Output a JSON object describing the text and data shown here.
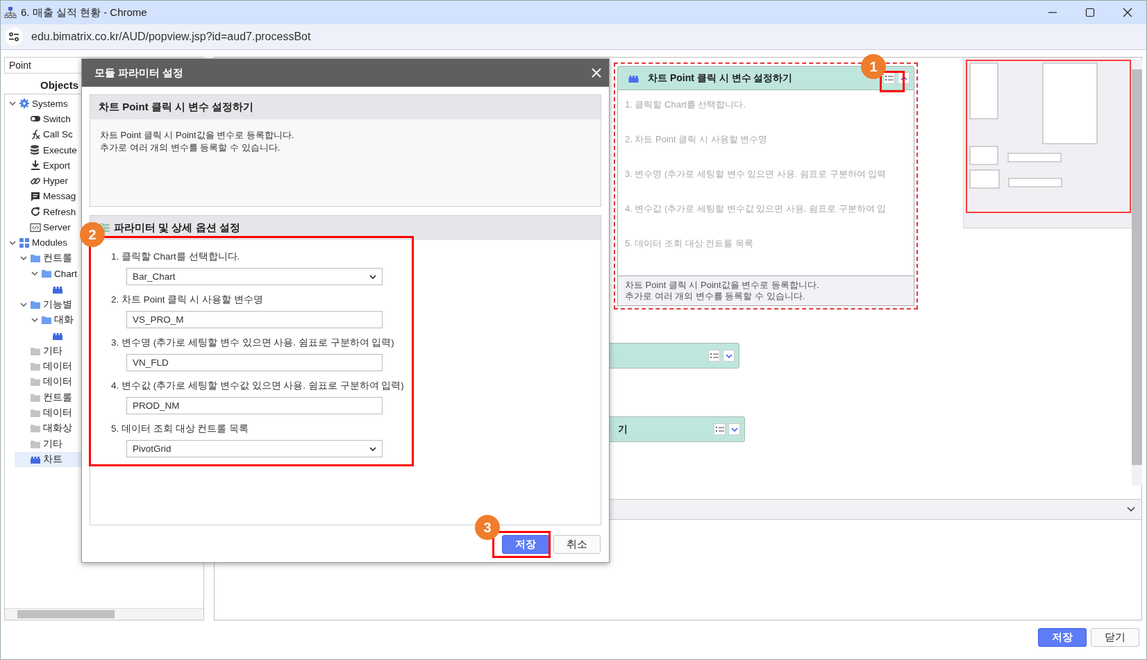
{
  "window": {
    "title": "6. 매출 실적 현황 - Chrome"
  },
  "address_bar": {
    "url": "edu.bimatrix.co.kr/AUD/popview.jsp?id=aud7.processBot"
  },
  "sidebar": {
    "search": {
      "value": "Point"
    },
    "header": "Objects",
    "tree": [
      {
        "label": "Systems",
        "kind": "gear",
        "expanded": true,
        "selected": false,
        "children": [
          {
            "label": "Switch",
            "kind": "toggle",
            "selected": false
          },
          {
            "label": "Call Sc",
            "kind": "function",
            "selected": false
          },
          {
            "label": "Execute",
            "kind": "database",
            "selected": false
          },
          {
            "label": "Export",
            "kind": "download",
            "selected": false
          },
          {
            "label": "Hyper",
            "kind": "link",
            "selected": false
          },
          {
            "label": "Messag",
            "kind": "message",
            "selected": false
          },
          {
            "label": "Refresh",
            "kind": "refresh",
            "selected": false
          },
          {
            "label": "Server",
            "kind": "code",
            "selected": false
          }
        ]
      },
      {
        "label": "Modules",
        "kind": "grid",
        "expanded": true,
        "selected": false,
        "children": [
          {
            "label": "컨트롤",
            "kind": "category",
            "expanded": true,
            "selected": false,
            "children": [
              {
                "label": "Chart",
                "kind": "category",
                "expanded": true,
                "selected": false,
                "children": [
                  {
                    "kind": "module",
                    "selected": false
                  }
                ]
              }
            ]
          },
          {
            "label": "기능별",
            "kind": "category",
            "expanded": true,
            "selected": false,
            "children": [
              {
                "label": "대화",
                "kind": "category",
                "expanded": true,
                "selected": false,
                "children": [
                  {
                    "kind": "module",
                    "selected": false
                  }
                ]
              }
            ]
          },
          {
            "label": "기타",
            "kind": "folder",
            "selected": false
          },
          {
            "label": "데이터",
            "kind": "folder",
            "selected": false
          },
          {
            "label": "데이터",
            "kind": "folder",
            "selected": false
          },
          {
            "label": "컨트롤",
            "kind": "folder",
            "selected": false
          },
          {
            "label": "데이터",
            "kind": "folder",
            "selected": false
          },
          {
            "label": "대화상",
            "kind": "folder",
            "selected": false
          },
          {
            "label": "기타",
            "kind": "folder",
            "selected": false
          },
          {
            "label": "차트",
            "kind": "module",
            "selected": true
          }
        ]
      }
    ]
  },
  "canvas": {
    "modules": [
      {
        "title": "차트 Point 클릭 시 변수 설정하기",
        "expanded": true,
        "selected": true,
        "params": [
          "1. 클릭할 Chart를 선택합니다.",
          "2. 차트 Point 클릭 시 사용할 변수명",
          "3. 변수명 (추가로 세팅할 변수 있으면 사용. 쉼표로 구분하여 입력",
          "4. 변수값 (추가로 세팅할 변수값 있으면 사용. 쉼표로 구분하여 입",
          "5. 데이터 조회 대상 컨트롤 목록"
        ],
        "description": [
          "차트 Point 클릭 시 Point값을 변수로 등록합니다.",
          "추가로  여러 개의 변수를 등록할 수 있습니다."
        ]
      },
      {
        "expanded": false,
        "selected": false
      },
      {
        "title": "기",
        "expanded": false,
        "selected": false
      }
    ]
  },
  "dialog": {
    "title": "모듈 파라미터 설정",
    "info": {
      "title": "차트 Point 클릭 시 변수 설정하기",
      "description": [
        "차트 Point 클릭 시 Point값을 변수로 등록합니다.",
        "추가로  여러 개의 변수를 등록할 수 있습니다."
      ]
    },
    "params": {
      "title": "파라미터 및 상세 옵션 설정",
      "fields": [
        {
          "label": "1. 클릭할 Chart를 선택합니다.",
          "kind": "select",
          "value": "Bar_Chart"
        },
        {
          "label": "2. 차트 Point 클릭 시 사용할 변수명",
          "kind": "text",
          "value": "VS_PRO_M"
        },
        {
          "label": "3. 변수명 (추가로 세팅할 변수 있으면 사용. 쉼표로 구분하여 입력)",
          "kind": "text",
          "value": "VN_FLD"
        },
        {
          "label": "4. 변수값 (추가로 세팅할 변수값 있으면 사용. 쉼표로 구분하여 입력)",
          "kind": "text",
          "value": "PROD_NM"
        },
        {
          "label": "5. 데이터 조회 대상 컨트롤 목록",
          "kind": "select",
          "value": "PivotGrid"
        }
      ]
    },
    "buttons": [
      {
        "label": "저장",
        "kind": "primary"
      },
      {
        "label": "취소",
        "kind": "secondary"
      }
    ]
  },
  "footer_buttons": [
    {
      "label": "저장",
      "kind": "primary"
    },
    {
      "label": "닫기",
      "kind": "secondary"
    }
  ],
  "annotations": [
    {
      "number": "1"
    },
    {
      "number": "2"
    },
    {
      "number": "3"
    }
  ]
}
